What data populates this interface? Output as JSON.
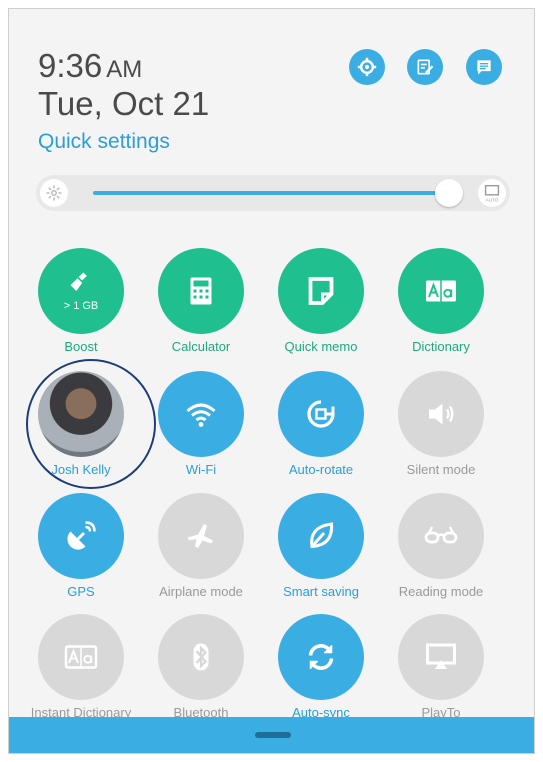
{
  "clock": {
    "time": "9:36",
    "ampm": "AM",
    "date": "Tue, Oct 21"
  },
  "header": {
    "title": "Quick settings"
  },
  "top_icons": [
    "settings-icon",
    "edit-icon",
    "chat-icon"
  ],
  "brightness": {
    "level": 0.95,
    "auto_label": "AUTO"
  },
  "colors": {
    "green": "#1fbf8f",
    "blue": "#3aaee3",
    "gray": "#d8d8d8"
  },
  "tiles": [
    {
      "label": "Boost",
      "sub": "> 1 GB",
      "state": "active",
      "icon": "broom-icon"
    },
    {
      "label": "Calculator",
      "state": "active",
      "icon": "calculator-icon"
    },
    {
      "label": "Quick memo",
      "state": "active",
      "icon": "memo-icon"
    },
    {
      "label": "Dictionary",
      "state": "active",
      "icon": "dictionary-icon"
    },
    {
      "label": "Josh Kelly",
      "state": "profile",
      "icon": "avatar"
    },
    {
      "label": "Wi-Fi",
      "state": "on",
      "icon": "wifi-icon"
    },
    {
      "label": "Auto-rotate",
      "state": "on",
      "icon": "rotate-icon"
    },
    {
      "label": "Silent mode",
      "state": "off",
      "icon": "speaker-icon"
    },
    {
      "label": "GPS",
      "state": "on",
      "icon": "gps-icon"
    },
    {
      "label": "Airplane mode",
      "state": "off",
      "icon": "airplane-icon"
    },
    {
      "label": "Smart saving",
      "state": "on",
      "icon": "leaf-icon"
    },
    {
      "label": "Reading mode",
      "state": "off",
      "icon": "glasses-icon"
    },
    {
      "label": "Instant Dictionary",
      "state": "off",
      "icon": "dictionary-icon"
    },
    {
      "label": "Bluetooth",
      "state": "off",
      "icon": "bluetooth-icon"
    },
    {
      "label": "Auto-sync",
      "state": "on",
      "icon": "sync-icon"
    },
    {
      "label": "PlayTo",
      "state": "off",
      "icon": "playto-icon"
    }
  ]
}
